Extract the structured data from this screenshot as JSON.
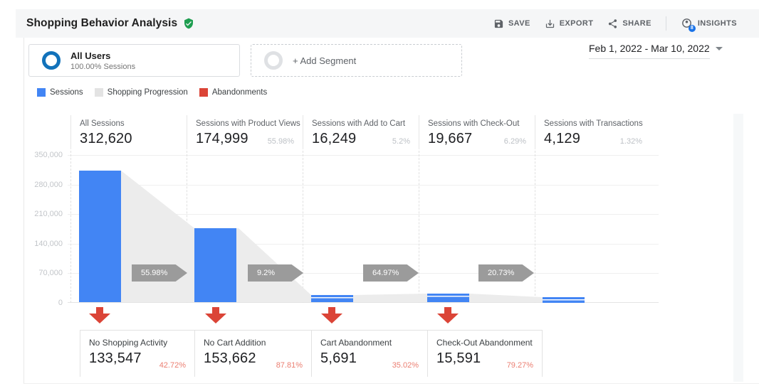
{
  "header": {
    "title": "Shopping Behavior Analysis",
    "insights_badge": "8",
    "actions": [
      {
        "label": "SAVE",
        "icon": "save-icon"
      },
      {
        "label": "EXPORT",
        "icon": "download-icon"
      },
      {
        "label": "SHARE",
        "icon": "share-icon"
      },
      {
        "label": "INSIGHTS",
        "icon": "insights-icon"
      }
    ]
  },
  "segments": {
    "all_users": {
      "name": "All Users",
      "detail": "100.00% Sessions"
    },
    "add_segment_label": "+ Add Segment",
    "date_range": "Feb 1, 2022 - Mar 10, 2022"
  },
  "legend": {
    "items": [
      {
        "label": "Sessions",
        "color": "#4285f4"
      },
      {
        "label": "Shopping Progression",
        "color": "#e3e3e3"
      },
      {
        "label": "Abandonments",
        "color": "#db4437"
      }
    ]
  },
  "chart_data": {
    "type": "bar",
    "subtype": "shopping-behavior-funnel",
    "title": "Shopping Behavior Analysis",
    "categories": [
      "All Sessions",
      "Sessions with Product Views",
      "Sessions with Add to Cart",
      "Sessions with Check-Out",
      "Sessions with Transactions"
    ],
    "values": [
      312620,
      174999,
      16249,
      19667,
      4129
    ],
    "ylim": [
      0,
      350000
    ],
    "y_ticks": [
      "350,000",
      "280,000",
      "210,000",
      "140,000",
      "70,000",
      "0"
    ],
    "grid": true,
    "steps": [
      {
        "label": "All Sessions",
        "value": "312,620",
        "pct": ""
      },
      {
        "label": "Sessions with Product Views",
        "value": "174,999",
        "pct": "55.98%"
      },
      {
        "label": "Sessions with Add to Cart",
        "value": "16,249",
        "pct": "5.2%"
      },
      {
        "label": "Sessions with Check-Out",
        "value": "19,667",
        "pct": "6.29%"
      },
      {
        "label": "Sessions with Transactions",
        "value": "4,129",
        "pct": "1.32%"
      }
    ],
    "progression_rates": [
      "55.98%",
      "9.2%",
      "64.97%",
      "20.73%"
    ],
    "abandonments": [
      {
        "label": "No Shopping Activity",
        "value": "133,547",
        "pct": "42.72%"
      },
      {
        "label": "No Cart Addition",
        "value": "153,662",
        "pct": "87.81%"
      },
      {
        "label": "Cart Abandonment",
        "value": "5,691",
        "pct": "35.02%"
      },
      {
        "label": "Check-Out Abandonment",
        "value": "15,591",
        "pct": "79.27%"
      }
    ],
    "colors": {
      "sessions": "#4285f4",
      "progression": "#ececec",
      "abandonment": "#db4437",
      "rate_arrow": "#9b9b9b"
    }
  }
}
